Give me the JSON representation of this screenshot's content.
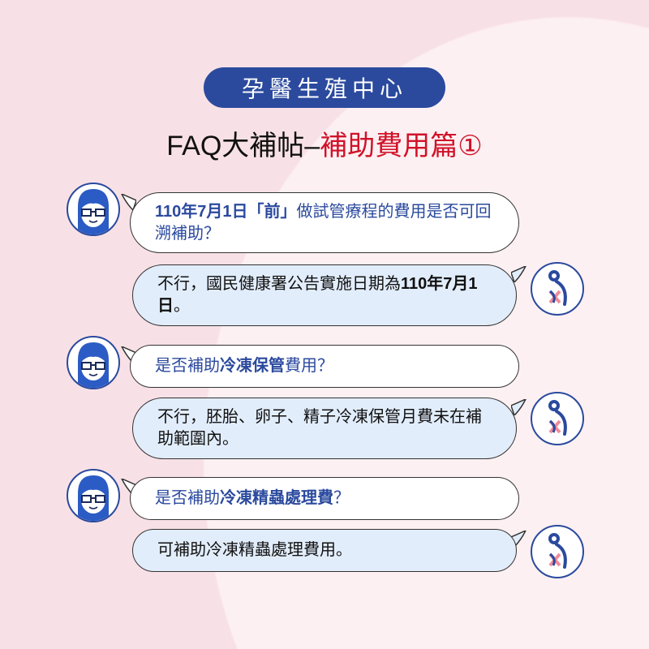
{
  "header": {
    "pill": "孕醫生殖中心",
    "title_black": "FAQ大補帖–",
    "title_red": "補助費用篇①"
  },
  "colors": {
    "brand_blue": "#2b4a9e",
    "accent_red": "#d01229",
    "answer_bg": "#e2edfb",
    "bg_pink": "#f8e1e6"
  },
  "icons": {
    "asker": "woman-avatar-icon",
    "answerer": "clinic-logo-icon"
  },
  "faq": [
    {
      "q": [
        {
          "t": "110年7月1日「前」",
          "b": true
        },
        {
          "t": "做試管療程的費用是否可回溯補助？",
          "b": false
        }
      ],
      "a": [
        {
          "t": "不行，國民健康署公告實施日期為",
          "b": false
        },
        {
          "t": "110年7月1日",
          "b": true
        },
        {
          "t": "。",
          "b": false
        }
      ]
    },
    {
      "q": [
        {
          "t": "是否補助",
          "b": false
        },
        {
          "t": "冷凍保管",
          "b": true
        },
        {
          "t": "費用？",
          "b": false
        }
      ],
      "a": [
        {
          "t": "不行，胚胎、卵子、精子冷凍保管月費未在補助範圍內。",
          "b": false
        }
      ]
    },
    {
      "q": [
        {
          "t": "是否補助",
          "b": false
        },
        {
          "t": "冷凍精蟲處理費",
          "b": true
        },
        {
          "t": "？",
          "b": false
        }
      ],
      "a": [
        {
          "t": "可補助冷凍精蟲處理費用。",
          "b": false
        }
      ]
    }
  ]
}
